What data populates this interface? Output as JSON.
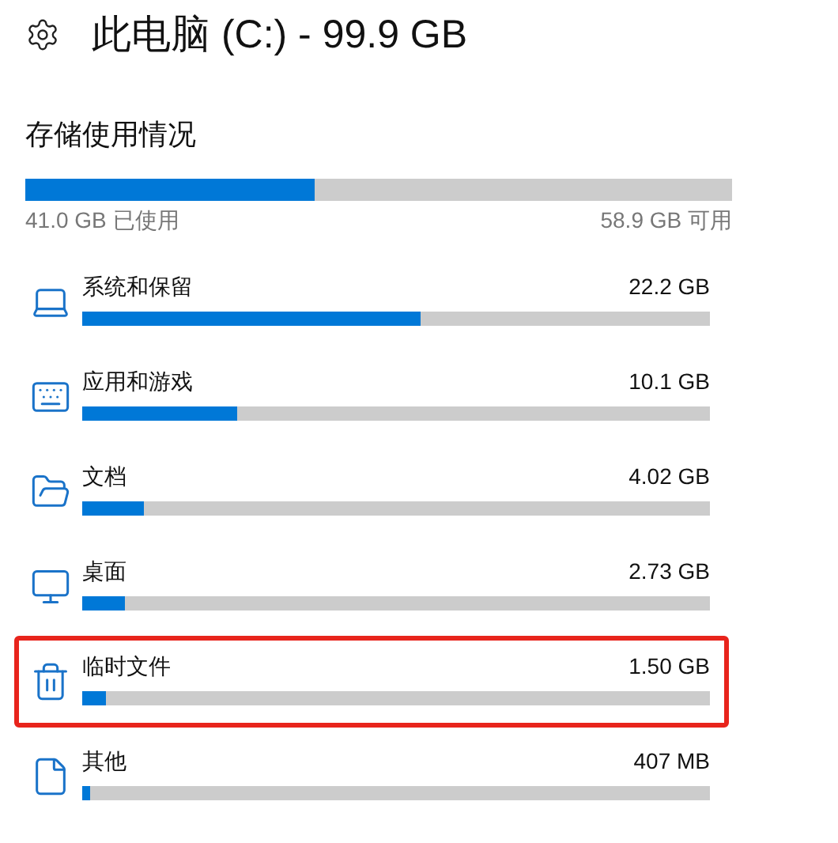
{
  "header": {
    "title": "此电脑 (C:) - 99.9 GB"
  },
  "usage": {
    "heading": "存储使用情况",
    "level": 0.41,
    "used": "41.0 GB 已使用",
    "free": "58.9 GB 可用"
  },
  "categories": [
    {
      "kind": "laptop",
      "label": "系统和保留",
      "size": "22.2 GB",
      "level": 0.54,
      "highlighted": false
    },
    {
      "kind": "keyboard",
      "label": "应用和游戏",
      "size": "10.1 GB",
      "level": 0.246,
      "highlighted": false
    },
    {
      "kind": "folder",
      "label": "文档",
      "size": "4.02 GB",
      "level": 0.098,
      "highlighted": false
    },
    {
      "kind": "monitor",
      "label": "桌面",
      "size": "2.73 GB",
      "level": 0.067,
      "highlighted": false
    },
    {
      "kind": "trash",
      "label": "临时文件",
      "size": "1.50 GB",
      "level": 0.037,
      "highlighted": true
    },
    {
      "kind": "file",
      "label": "其他",
      "size": "407 MB",
      "level": 0.012,
      "highlighted": false
    }
  ]
}
